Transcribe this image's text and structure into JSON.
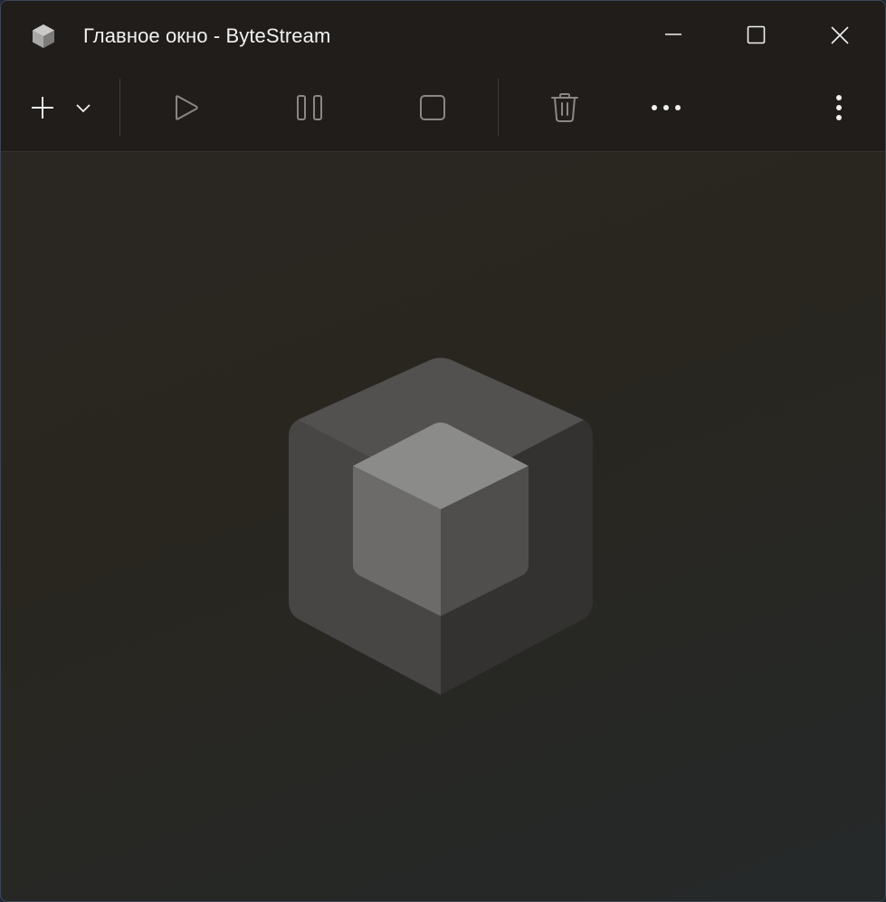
{
  "window": {
    "title": "Главное окно - ByteStream",
    "app_icon": "app-cube-icon"
  },
  "caption_buttons": {
    "minimize": "minimize-icon",
    "maximize": "maximize-icon",
    "close": "close-icon"
  },
  "toolbar": {
    "buttons": [
      {
        "name": "add-button",
        "icon": "plus-icon"
      },
      {
        "name": "add-dropdown-button",
        "icon": "chevron-down-icon"
      },
      {
        "name": "play-button",
        "icon": "play-icon"
      },
      {
        "name": "pause-button",
        "icon": "pause-icon"
      },
      {
        "name": "stop-button",
        "icon": "stop-icon"
      },
      {
        "name": "delete-button",
        "icon": "trash-icon"
      },
      {
        "name": "more-button",
        "icon": "more-horizontal-icon"
      },
      {
        "name": "overflow-menu-button",
        "icon": "more-vertical-icon"
      }
    ]
  },
  "content": {
    "empty_state_icon": "cube-logo-icon"
  },
  "colors": {
    "titlebar_bg": "#201d1b",
    "content_bg": "#29261f",
    "text": "#f2f2f2",
    "icon_enabled": "#f2f2f2",
    "icon_disabled": "#8a8785"
  }
}
